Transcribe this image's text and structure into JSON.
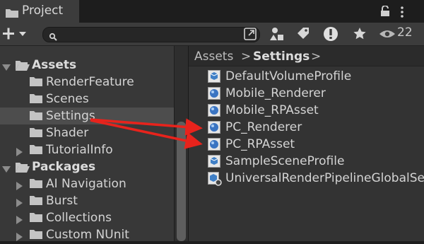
{
  "window": {
    "tab_title": "Project",
    "hidden_count": "22"
  },
  "search": {
    "value": "",
    "placeholder": ""
  },
  "tree": [
    {
      "label": "Assets",
      "bold": true,
      "expanded": true
    },
    {
      "label": "RenderFeature"
    },
    {
      "label": "Scenes"
    },
    {
      "label": "Settings",
      "selected": true
    },
    {
      "label": "Shader"
    },
    {
      "label": "TutorialInfo",
      "collapsed": true
    },
    {
      "label": "Packages",
      "bold": true,
      "expanded": true
    },
    {
      "label": "AI Navigation",
      "collapsed": true
    },
    {
      "label": "Burst",
      "collapsed": true
    },
    {
      "label": "Collections",
      "collapsed": true
    },
    {
      "label": "Custom NUnit",
      "collapsed": true
    }
  ],
  "breadcrumb": {
    "root": "Assets",
    "sep1": ">",
    "current": "Settings",
    "sep2": ">"
  },
  "assets": [
    {
      "label": "DefaultVolumeProfile",
      "icon": "cube-asset-icon"
    },
    {
      "label": "Mobile_Renderer",
      "icon": "render-asset-icon"
    },
    {
      "label": "Mobile_RPAsset",
      "icon": "render-asset-icon"
    },
    {
      "label": "PC_Renderer",
      "icon": "render-asset-icon"
    },
    {
      "label": "PC_RPAsset",
      "icon": "render-asset-icon"
    },
    {
      "label": "SampleSceneProfile",
      "icon": "cube-asset-icon"
    },
    {
      "label": "UniversalRenderPipelineGlobalSe",
      "icon": "settings-asset-icon"
    }
  ],
  "colors": {
    "arrow": "#e8231c",
    "panel": "#383838",
    "selected_row": "#4d4d4d"
  }
}
